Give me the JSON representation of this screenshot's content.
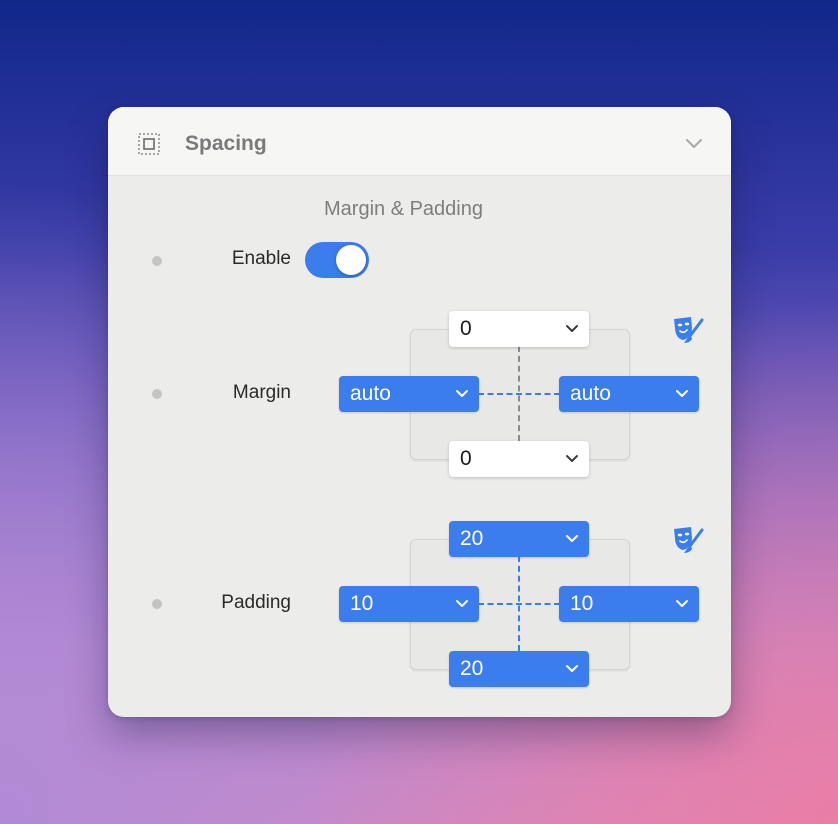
{
  "panel": {
    "title": "Spacing",
    "icon": "spacing-box-icon",
    "collapse_icon": "chevron-down-icon"
  },
  "section": {
    "title": "Margin & Padding"
  },
  "enable": {
    "label": "Enable",
    "checked": true
  },
  "margin": {
    "label": "Margin",
    "top": "0",
    "left": "auto",
    "right": "auto",
    "bottom": "0",
    "theme_icon": "theater-masks-brush-icon"
  },
  "padding": {
    "label": "Padding",
    "top": "20",
    "left": "10",
    "right": "10",
    "bottom": "20",
    "theme_icon": "theater-masks-brush-icon"
  },
  "colors": {
    "accent": "#3b7ded",
    "panel_bg": "#ececea",
    "header_bg": "#f6f6f5"
  }
}
